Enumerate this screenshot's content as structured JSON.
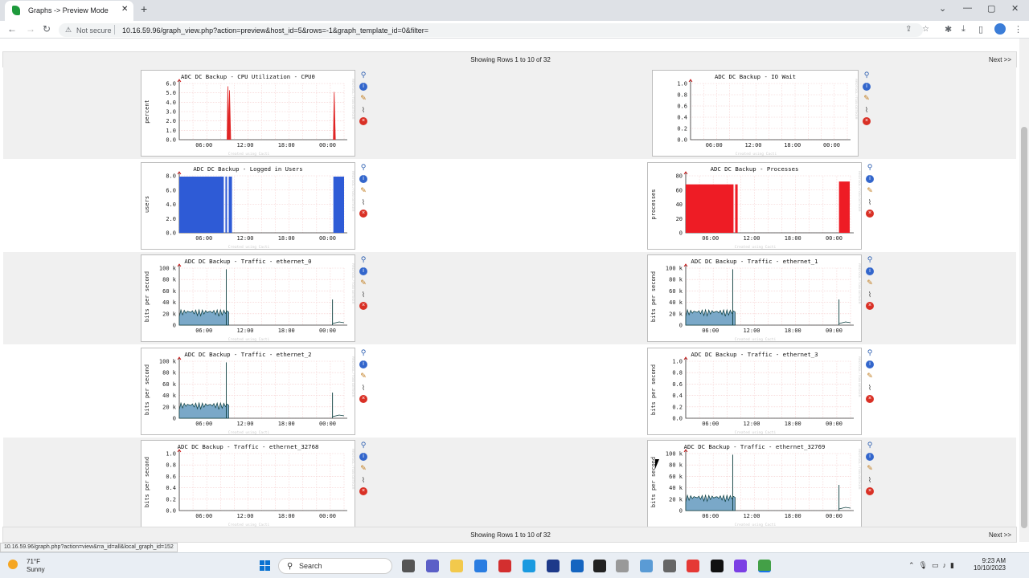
{
  "browser": {
    "tab_title": "Graphs -> Preview Mode",
    "not_secure": "Not secure",
    "url": "10.16.59.96/graph_view.php?action=preview&host_id=5&rows=-1&graph_template_id=0&filter=",
    "new_tab_label": "+",
    "status_url": "10.16.59.96/graph.php?action=view&rra_id=all&local_graph_id=152"
  },
  "pager": {
    "showing": "Showing Rows 1 to 10 of 32",
    "next": "Next >>"
  },
  "colors": {
    "cpu": "#e02424",
    "users": "#2e5bd6",
    "processes": "#ee1c25",
    "traffic_in": "#7aa8c8",
    "traffic_out": "#0b3d3d",
    "band_alt": "#f0f0f0",
    "grid": "#f4caca",
    "axis": "#333333"
  },
  "x_ticks": [
    "06:00",
    "12:00",
    "18:00",
    "00:00"
  ],
  "watermark": "Created using Cacti",
  "graphs": [
    {
      "title": "ADC DC Backup - CPU Utilization - CPU0",
      "ylabel": "percent",
      "yticks": [
        "6.0",
        "5.0",
        "4.0",
        "3.0",
        "2.0",
        "1.0",
        "0.0"
      ],
      "type": "cpu"
    },
    {
      "title": "ADC DC Backup - IO Wait",
      "ylabel": "",
      "yticks": [
        "1.0",
        "0.8",
        "0.6",
        "0.4",
        "0.2",
        "0.0"
      ],
      "type": "empty"
    },
    {
      "title": "ADC DC Backup - Logged in Users",
      "ylabel": "users",
      "yticks": [
        "8.0",
        "6.0",
        "4.0",
        "2.0",
        "0.0"
      ],
      "type": "users"
    },
    {
      "title": "ADC DC Backup - Processes",
      "ylabel": "processes",
      "yticks": [
        "80",
        "60",
        "40",
        "20",
        "0"
      ],
      "type": "processes"
    },
    {
      "title": "ADC DC Backup - Traffic - ethernet_0",
      "ylabel": "bits per second",
      "yticks": [
        "100 k",
        "80 k",
        "60 k",
        "40 k",
        "20 k",
        "0"
      ],
      "type": "traffic"
    },
    {
      "title": "ADC DC Backup - Traffic - ethernet_1",
      "ylabel": "bits per second",
      "yticks": [
        "100 k",
        "80 k",
        "60 k",
        "40 k",
        "20 k",
        "0"
      ],
      "type": "traffic"
    },
    {
      "title": "ADC DC Backup - Traffic - ethernet_2",
      "ylabel": "bits per second",
      "yticks": [
        "100 k",
        "80 k",
        "60 k",
        "40 k",
        "20 k",
        "0"
      ],
      "type": "traffic"
    },
    {
      "title": "ADC DC Backup - Traffic - ethernet_3",
      "ylabel": "bits per second",
      "yticks": [
        "1.0",
        "0.8",
        "0.6",
        "0.4",
        "0.2",
        "0.0"
      ],
      "type": "empty"
    },
    {
      "title": "ADC DC Backup - Traffic - ethernet_32768",
      "ylabel": "bits per second",
      "yticks": [
        "1.0",
        "0.8",
        "0.6",
        "0.4",
        "0.2",
        "0.0"
      ],
      "type": "empty"
    },
    {
      "title": "ADC DC Backup - Traffic - ethernet_32769",
      "ylabel": "bits per second",
      "yticks": [
        "100 k",
        "80 k",
        "60 k",
        "40 k",
        "20 k",
        "0"
      ],
      "type": "traffic"
    }
  ],
  "graph_actions": [
    "zoom-icon",
    "info-icon",
    "edit-icon",
    "trend-icon",
    "delete-icon"
  ],
  "taskbar": {
    "temp": "71°F",
    "condition": "Sunny",
    "search": "Search",
    "time": "9:23 AM",
    "date": "10/10/2023"
  }
}
